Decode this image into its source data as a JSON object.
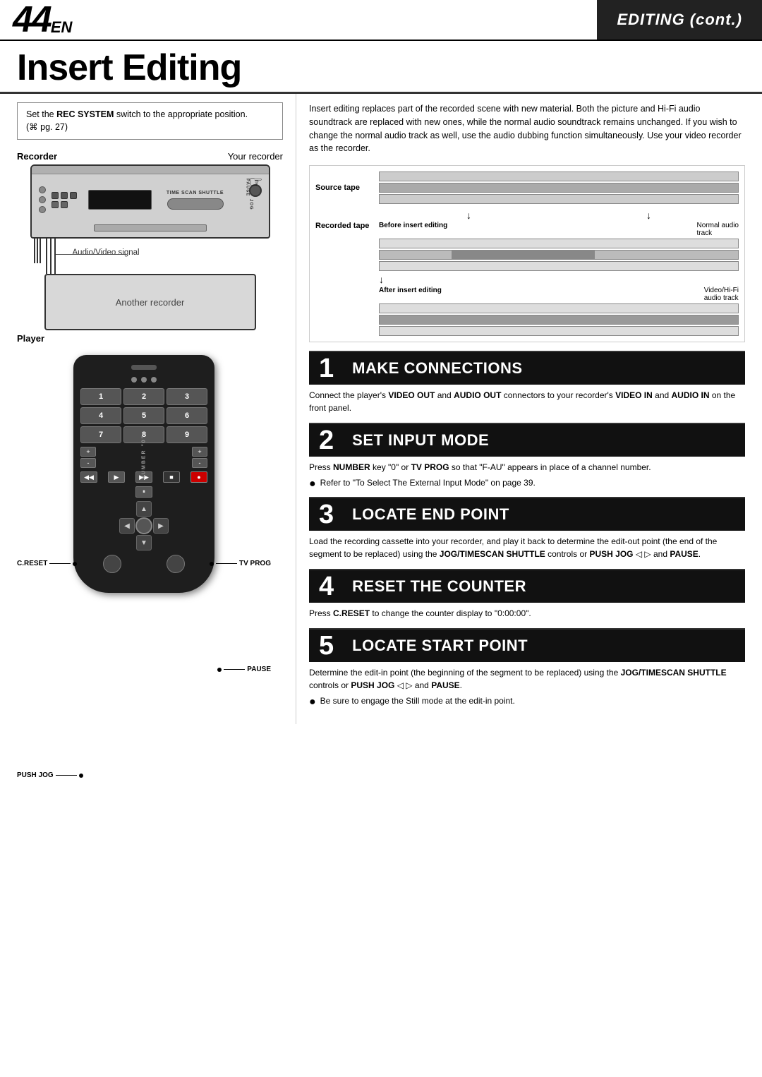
{
  "header": {
    "page_number": "44",
    "page_en": "EN",
    "section": "EDITING (cont.)"
  },
  "page_title": "Insert Editing",
  "notice": {
    "text": "Set the REC SYSTEM switch to the appropriate position.",
    "page_ref": "(⌘ pg. 27)"
  },
  "diagram": {
    "recorder_label_bold": "Recorder",
    "recorder_label": "Your recorder",
    "timescan_label": "TIME SCAN SHUTTLE",
    "pause_label": "PAUSE",
    "jog_label": "JOG",
    "av_signal_label": "Audio/Video signal",
    "another_recorder_label": "Another recorder",
    "player_label": "Player"
  },
  "tape_diagram": {
    "source_tape_label": "Source tape",
    "recorded_tape_label": "Recorded tape",
    "before_insert_label": "Before insert editing",
    "after_insert_label": "After insert editing",
    "normal_audio_label": "Normal audio",
    "track_label": "track",
    "video_hifi_label": "Video/Hi-Fi",
    "audio_track_label": "audio track"
  },
  "intro_text": "Insert editing replaces part of the recorded scene with new material. Both the picture and Hi-Fi audio soundtrack are replaced with new ones, while the normal audio soundtrack remains unchanged. If you wish to change the normal audio track as well, use the audio dubbing function simultaneously. Use your video recorder as the recorder.",
  "steps": [
    {
      "number": "1",
      "title": "MAKE CONNECTIONS",
      "body": "Connect the player’s VIDEO OUT and AUDIO OUT connectors to your recorder’s VIDEO IN and AUDIO IN on the front panel."
    },
    {
      "number": "2",
      "title": "SET INPUT MODE",
      "body": "Press NUMBER key “0” or TV PROG so that “F-AU” appears in place of a channel number.",
      "bullet": "Refer to “To Select The External Input Mode” on page 39."
    },
    {
      "number": "3",
      "title": "LOCATE END POINT",
      "body": "Load the recording cassette into your recorder, and play it back to determine the edit-out point (the end of the segment to be replaced) using the JOG/TIMESCAN SHUTTLE controls or PUSH JOG ◁ ▷ and PAUSE."
    },
    {
      "number": "4",
      "title": "RESET THE COUNTER",
      "body": "Press C.RESET to change the counter display to “0:00:00”."
    },
    {
      "number": "5",
      "title": "LOCATE START POINT",
      "body": "Determine the edit-in point (the beginning of the segment to be replaced) using the JOG/TIMESCAN SHUTTLE controls or PUSH JOG ◁ ▷ and PAUSE.",
      "bullet": "Be sure to engage the Still mode at the edit-in point."
    }
  ],
  "remote_labels": {
    "creset": "C.RESET",
    "tvprog": "TV PROG",
    "number": "NUMBER “0”",
    "pause": "PAUSE",
    "push_jog": "PUSH JOG"
  }
}
